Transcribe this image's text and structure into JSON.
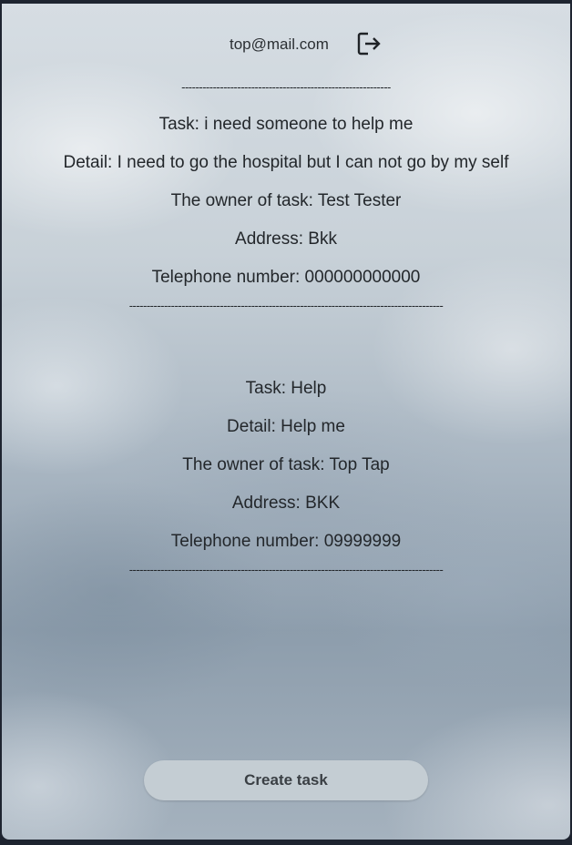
{
  "header": {
    "email": "top@mail.com",
    "logout_icon": "logout-icon"
  },
  "divider_short": "------------------------------------------------------------",
  "divider_long": "------------------------------------------------------------------------------------------",
  "tasks": [
    {
      "task": "Task: i need someone to help me",
      "detail": "Detail: I need to go the hospital but I can not go by my self",
      "owner": "The owner of task: Test Tester",
      "address": "Address: Bkk",
      "phone": "Telephone number: 000000000000"
    },
    {
      "task": "Task: Help",
      "detail": "Detail: Help me",
      "owner": "The owner of task: Top Tap",
      "address": "Address: BKK",
      "phone": "Telephone number: 09999999"
    }
  ],
  "create_button_label": "Create task"
}
